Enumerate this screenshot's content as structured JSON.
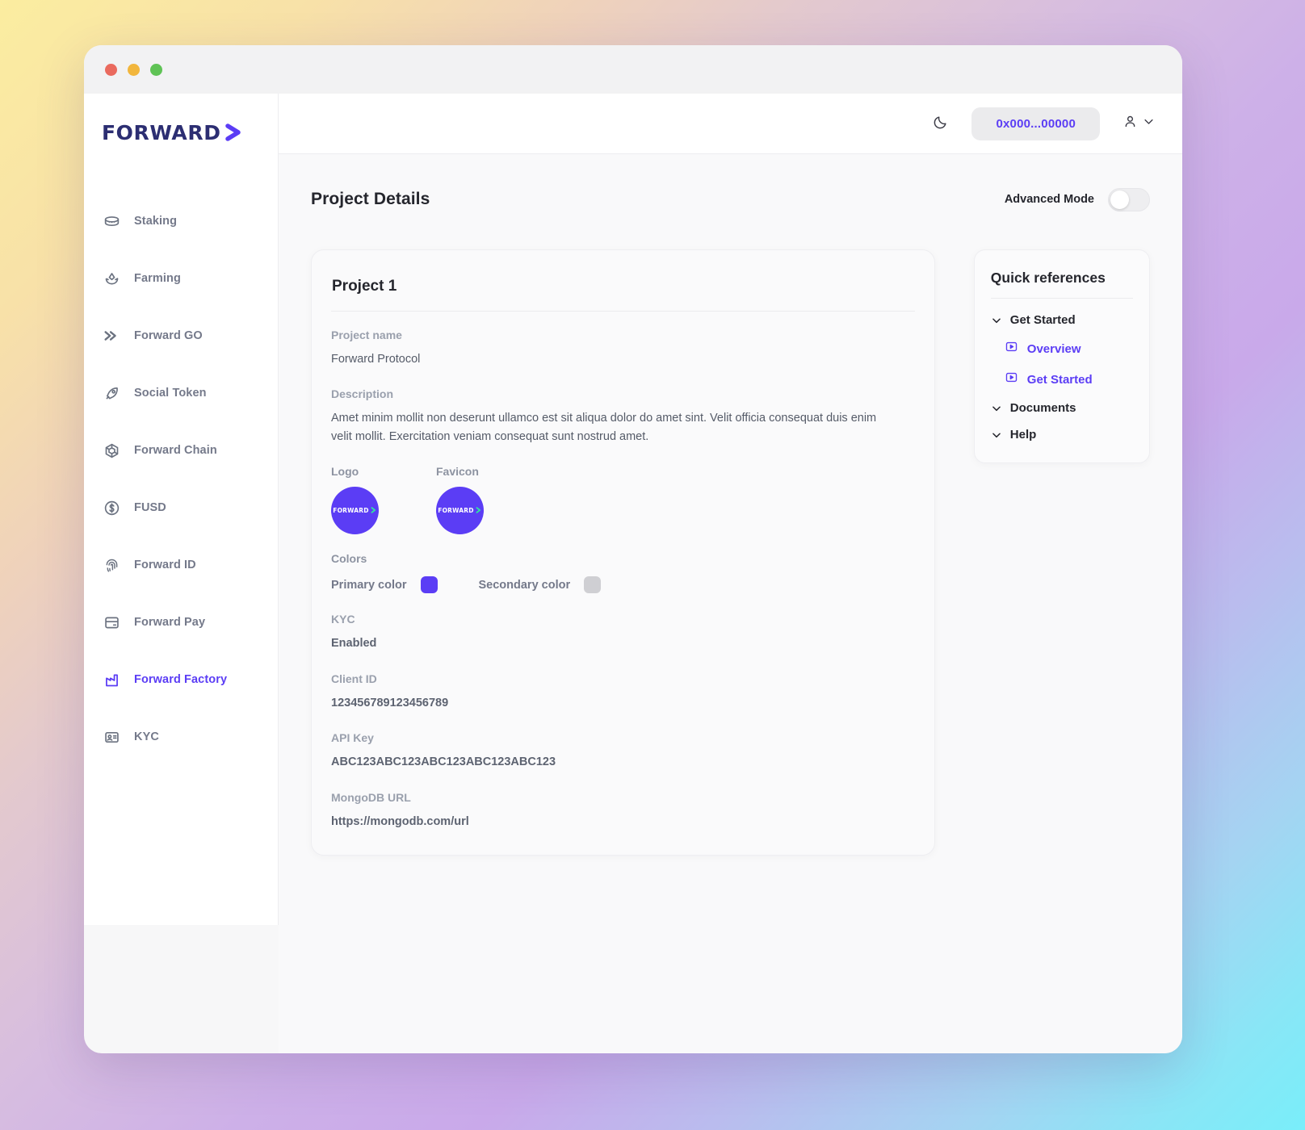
{
  "window": {
    "traffic_lights": [
      "close",
      "minimize",
      "maximize"
    ]
  },
  "brand": {
    "logo_text": "FORWARD",
    "logo_arrow_icon": "chevron-right-icon",
    "primary_color": "#5b3df5",
    "logo_text_color": "#2c2e72"
  },
  "sidebar": {
    "items": [
      {
        "label": "Staking",
        "icon": "coins-stack-icon",
        "active": false
      },
      {
        "label": "Farming",
        "icon": "sprout-icon",
        "active": false
      },
      {
        "label": "Forward GO",
        "icon": "double-chevron-right-icon",
        "active": false
      },
      {
        "label": "Social Token",
        "icon": "rocket-icon",
        "active": false
      },
      {
        "label": "Forward Chain",
        "icon": "hexagon-cube-icon",
        "active": false
      },
      {
        "label": "FUSD",
        "icon": "dollar-coin-icon",
        "active": false
      },
      {
        "label": "Forward ID",
        "icon": "fingerprint-icon",
        "active": false
      },
      {
        "label": "Forward Pay",
        "icon": "credit-card-icon",
        "active": false
      },
      {
        "label": "Forward Factory",
        "icon": "factory-icon",
        "active": true
      },
      {
        "label": "KYC",
        "icon": "id-card-icon",
        "active": false
      }
    ]
  },
  "topbar": {
    "theme_toggle_icon": "moon-icon",
    "wallet_address": "0x000...00000",
    "user_icon": "user-icon",
    "user_chevron_icon": "chevron-down-icon"
  },
  "page": {
    "title": "Project Details",
    "advanced_mode_label": "Advanced Mode",
    "advanced_mode_enabled": false
  },
  "project_card": {
    "title": "Project 1",
    "fields": {
      "project_name_label": "Project name",
      "project_name_value": "Forward Protocol",
      "description_label": "Description",
      "description_value": "Amet minim mollit non deserunt ullamco est sit aliqua dolor do amet sint. Velit officia consequat duis enim velit mollit. Exercitation veniam consequat sunt nostrud amet.",
      "logo_label": "Logo",
      "favicon_label": "Favicon",
      "colors_label": "Colors",
      "primary_color_label": "Primary color",
      "primary_color_value": "#5b3df5",
      "secondary_color_label": "Secondary color",
      "secondary_color_value": "#cfcfd3",
      "kyc_label": "KYC",
      "kyc_value": "Enabled",
      "client_id_label": "Client ID",
      "client_id_value": "123456789123456789",
      "api_key_label": "API Key",
      "api_key_value": "ABC123ABC123ABC123ABC123ABC123",
      "mongodb_url_label": "MongoDB URL",
      "mongodb_url_value": "https://mongodb.com/url"
    }
  },
  "quick_references": {
    "title": "Quick references",
    "groups": [
      {
        "label": "Get Started",
        "chevron_icon": "chevron-down-icon",
        "links": [
          {
            "label": "Overview",
            "icon": "video-play-icon"
          },
          {
            "label": "Get Started",
            "icon": "video-play-icon"
          }
        ]
      },
      {
        "label": "Documents",
        "chevron_icon": "chevron-down-icon",
        "links": []
      },
      {
        "label": "Help",
        "chevron_icon": "chevron-down-icon",
        "links": []
      }
    ]
  }
}
